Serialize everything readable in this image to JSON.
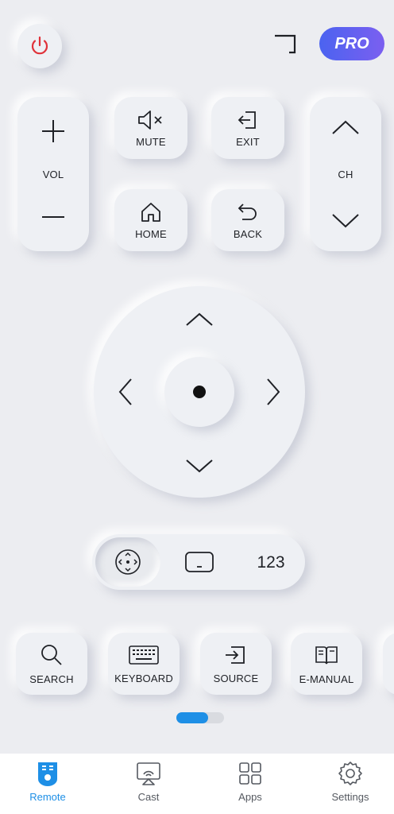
{
  "header": {
    "pro_label": "PRO"
  },
  "buttons": {
    "vol_label": "VOL",
    "ch_label": "CH",
    "mute_label": "MUTE",
    "exit_label": "EXIT",
    "home_label": "HOME",
    "back_label": "BACK"
  },
  "mode_bar": {
    "numeric_label": "123"
  },
  "bottom_row": [
    {
      "label": "SEARCH"
    },
    {
      "label": "KEYBOARD"
    },
    {
      "label": "SOURCE"
    },
    {
      "label": "E-MANUAL"
    }
  ],
  "pager": {
    "pages": 2,
    "active": 1
  },
  "tabs": [
    {
      "label": "Remote",
      "active": true
    },
    {
      "label": "Cast",
      "active": false
    },
    {
      "label": "Apps",
      "active": false
    },
    {
      "label": "Settings",
      "active": false
    }
  ],
  "colors": {
    "accent": "#1e8fe6",
    "power": "#e0323a",
    "pro_start": "#4b63f0",
    "pro_end": "#7b5ff0",
    "background": "#ecedf1"
  }
}
